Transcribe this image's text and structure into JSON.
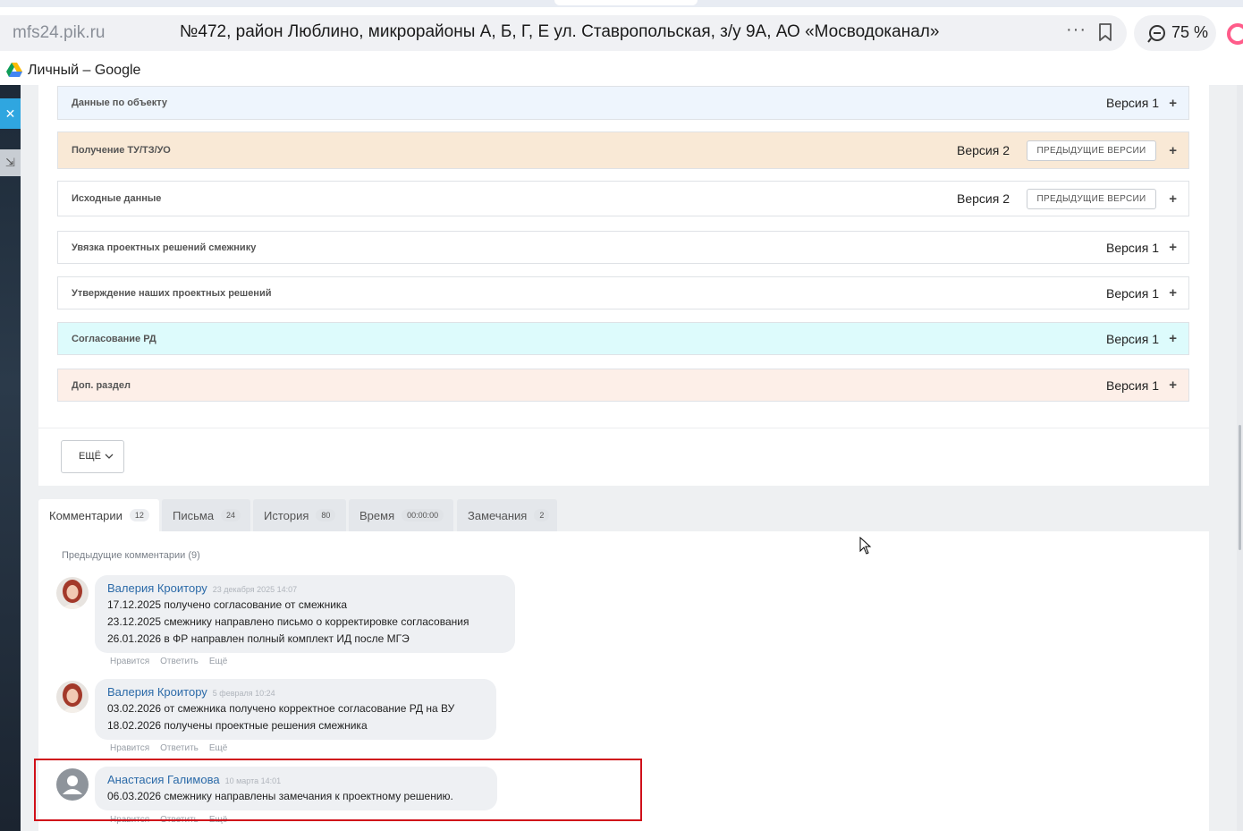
{
  "browser": {
    "domain": "mfs24.pik.ru",
    "page_title": "№472, район Люблино, микрорайоны А, Б, Г, Е ул. Ставропольская, з/у 9А, АО «Мосводоканал»",
    "more": "···",
    "zoom": "75 %",
    "bookmark_label": "Личный – Google"
  },
  "sections": [
    {
      "title": "Данные по объекту",
      "version": "Версия 1",
      "plus": "+",
      "color": "#eef5fd"
    },
    {
      "title": "Получение ТУ/ТЗ/УО",
      "version": "Версия 2",
      "prev": "ПРЕДЫДУЩИЕ ВЕРСИИ",
      "plus": "+",
      "color": "#f9e9d6"
    },
    {
      "title": "Исходные данные",
      "version": "Версия 2",
      "prev": "ПРЕДЫДУЩИЕ ВЕРСИИ",
      "plus": "+",
      "color": "#ffffff"
    },
    {
      "title": "Увязка проектных решений смежнику",
      "version": "Версия 1",
      "plus": "+",
      "color": "#ffffff"
    },
    {
      "title": "Утверждение наших проектных решений",
      "version": "Версия 1",
      "plus": "+",
      "color": "#ffffff"
    },
    {
      "title": "Согласование РД",
      "version": "Версия 1",
      "plus": "+",
      "color": "#ddfbfc"
    },
    {
      "title": "Доп. раздел",
      "version": "Версия 1",
      "plus": "+",
      "color": "#fdefe8"
    }
  ],
  "more_button": "ЕЩЁ",
  "tabs": [
    {
      "label": "Комментарии",
      "count": "12"
    },
    {
      "label": "Письма",
      "count": "24"
    },
    {
      "label": "История",
      "count": "80"
    },
    {
      "label": "Время",
      "count": "00:00:00"
    },
    {
      "label": "Замечания",
      "count": "2"
    }
  ],
  "comments": {
    "previous": "Предыдущие комментарии (9)",
    "items": [
      {
        "author": "Валерия Кроитору",
        "date": "23 декабря 2025 14:07",
        "lines": [
          "17.12.2025 получено согласование от смежника",
          "23.12.2025 смежнику направлено письмо о корректировке согласования",
          "26.01.2026 в ФР направлен полный комплект ИД после МГЭ"
        ],
        "actions": [
          "Нравится",
          "Ответить",
          "Ещё"
        ]
      },
      {
        "author": "Валерия Кроитору",
        "date": "5 февраля 10:24",
        "lines": [
          "03.02.2026 от смежника получено корректное согласование РД на ВУ",
          "18.02.2026 получены проектные решения смежника"
        ],
        "actions": [
          "Нравится",
          "Ответить",
          "Ещё"
        ]
      },
      {
        "author": "Анастасия Галимова",
        "date": "10 марта 14:01",
        "lines": [
          "06.03.2026 смежнику направлены замечания к проектному решению."
        ],
        "actions": [
          "Нравится",
          "Ответить",
          "Ещё"
        ]
      }
    ]
  }
}
